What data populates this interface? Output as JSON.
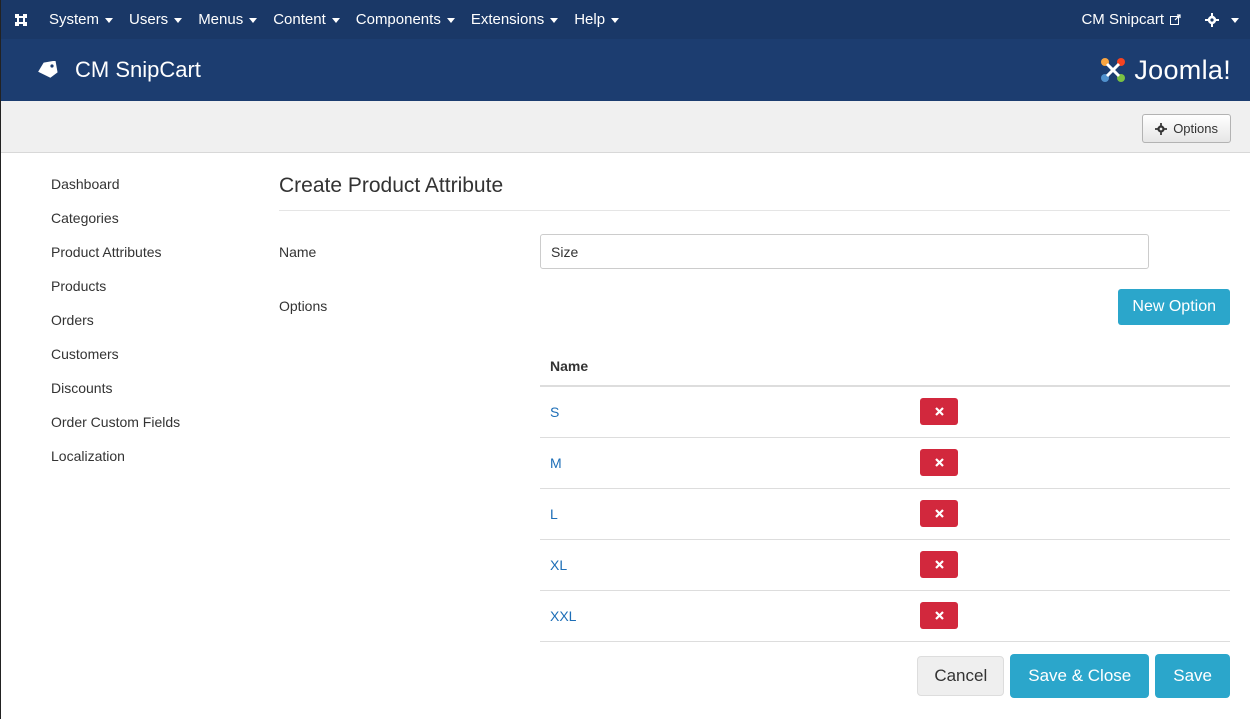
{
  "topnav": {
    "menus": [
      "System",
      "Users",
      "Menus",
      "Content",
      "Components",
      "Extensions",
      "Help"
    ],
    "site_link": "CM Snipcart"
  },
  "header": {
    "title": "CM SnipCart",
    "logo_text": "Joomla!"
  },
  "toolbar": {
    "options_label": "Options"
  },
  "sidebar": {
    "items": [
      {
        "label": "Dashboard"
      },
      {
        "label": "Categories"
      },
      {
        "label": "Product Attributes"
      },
      {
        "label": "Products"
      },
      {
        "label": "Orders"
      },
      {
        "label": "Customers"
      },
      {
        "label": "Discounts"
      },
      {
        "label": "Order Custom Fields"
      },
      {
        "label": "Localization"
      }
    ]
  },
  "form": {
    "title": "Create Product Attribute",
    "name_label": "Name",
    "name_value": "Size",
    "options_label": "Options",
    "new_option_label": "New Option",
    "table_header": "Name",
    "option_rows": [
      "S",
      "M",
      "L",
      "XL",
      "XXL"
    ]
  },
  "actions": {
    "cancel": "Cancel",
    "save_close": "Save & Close",
    "save": "Save"
  },
  "colors": {
    "navbar": "#1a3867",
    "header": "#1c3d70",
    "primary_button": "#2ba6cb",
    "danger_button": "#d2283d",
    "link": "#1d6eb7"
  }
}
